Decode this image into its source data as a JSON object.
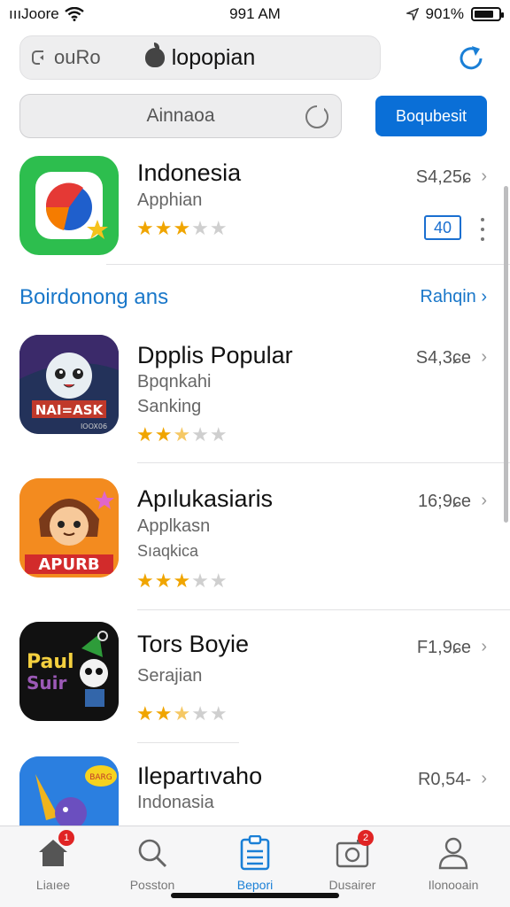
{
  "status_bar": {
    "carrier": "ıııJoore",
    "time": "991 AM",
    "battery": "901%"
  },
  "top_bar": {
    "back_label": "ouRo",
    "title": "lopopian"
  },
  "search": {
    "placeholder": "Ainnaoa",
    "button_label": "Boqubesit"
  },
  "featured": {
    "name": "Indonesia",
    "subtitle": "Apphian",
    "price": "S4,25ɕ",
    "rating": 3,
    "badge": "40"
  },
  "section": {
    "title": "Boirdonong ans",
    "link": "Rahqin"
  },
  "apps": [
    {
      "name": "Dpplis Popular",
      "subtitle": "Bpqnkahi",
      "subtitle2": "Sanking",
      "price": "S4,3ɕe",
      "rating": 2.5,
      "icon": "game-icon-character"
    },
    {
      "name": "Apılukasiaris",
      "subtitle": "Applkasn",
      "subtitle2": "Sıaqkica",
      "price": "16;9ɕe",
      "rating": 3,
      "icon": "apurb-icon-character"
    },
    {
      "name": "Tors Boyie",
      "subtitle": "Serajian",
      "subtitle2": "",
      "price": "F1,9ɕe",
      "rating": 2.5,
      "icon": "paul-skull-icon"
    },
    {
      "name": "Ilepartıvaho",
      "subtitle": "Indonasia",
      "subtitle2": "",
      "price": "R0,54-",
      "rating": 0,
      "icon": "party-hat-icon"
    }
  ],
  "tabs": [
    {
      "label": "Liaıee",
      "icon": "home-icon",
      "badge": "1"
    },
    {
      "label": "Posston",
      "icon": "search-icon",
      "badge": ""
    },
    {
      "label": "Bepori",
      "icon": "clipboard-icon",
      "badge": "",
      "active": true
    },
    {
      "label": "Dusairer",
      "icon": "camera-icon",
      "badge": "2"
    },
    {
      "label": "Ilonooain",
      "icon": "person-icon",
      "badge": ""
    }
  ],
  "colors": {
    "accent": "#0a6fd7",
    "link": "#1977c9",
    "star": "#f0a500",
    "badge": "#e02424"
  }
}
